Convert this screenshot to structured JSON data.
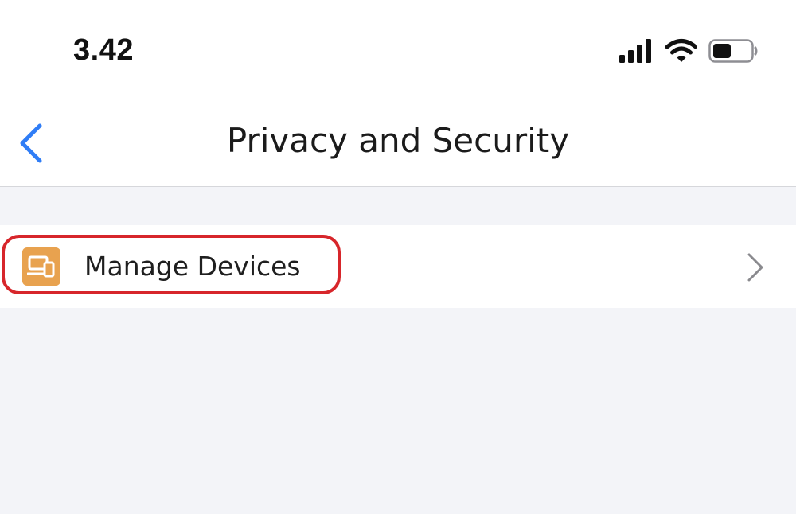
{
  "status_bar": {
    "time": "3.42",
    "icons": [
      "signal-icon",
      "wifi-icon",
      "battery-icon"
    ]
  },
  "nav": {
    "back_icon": "chevron-left-icon",
    "title": "Privacy and Security"
  },
  "list": {
    "items": [
      {
        "label": "Manage Devices",
        "icon": "devices-icon",
        "icon_color": "#e8a24f",
        "trailing": "chevron-right-icon"
      }
    ]
  },
  "annotation": {
    "highlight_color": "#d7262b"
  },
  "colors": {
    "accent": "#2f7df6",
    "background": "#f3f4f8"
  }
}
